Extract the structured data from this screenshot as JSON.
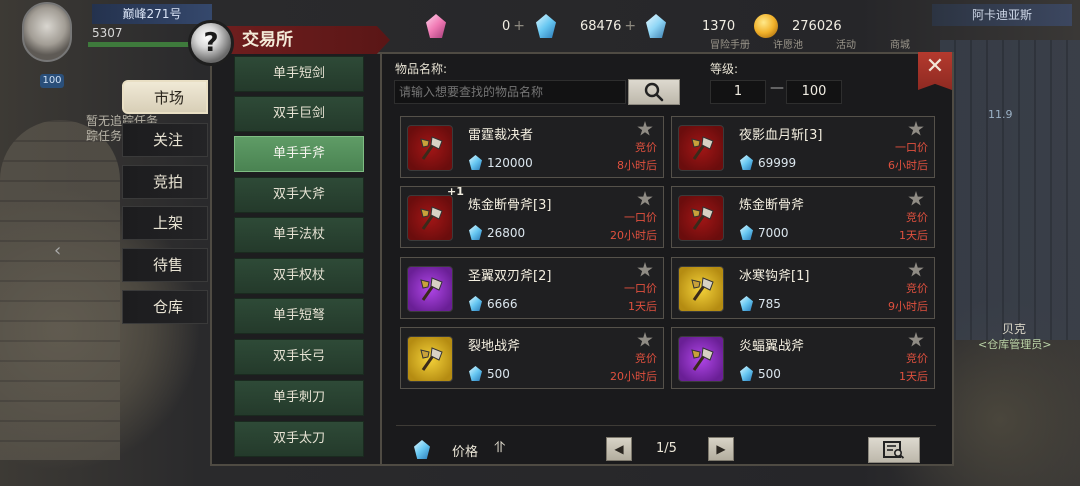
{
  "player": {
    "name": "巅峰271号",
    "hp": "5307",
    "level": "100"
  },
  "background": {
    "left_text": [
      "暂无追踪任务",
      "踪任务"
    ],
    "region": "阿卡迪亚斯",
    "npc_name": "贝克",
    "npc_role": "<仓库管理员>",
    "distance": "11.9"
  },
  "top_menu": [
    "冒险手册",
    "许愿池",
    "活动",
    "商城"
  ],
  "title": "交易所",
  "currencies": [
    {
      "icon": "pink-gem-icon",
      "value": "0"
    },
    {
      "icon": "blue-gem-icon",
      "value": "68476"
    },
    {
      "icon": "bound-gem-icon",
      "value": "1370"
    },
    {
      "icon": "gold-coin-icon",
      "value": "276026"
    }
  ],
  "side_tabs": [
    "市场",
    "关注",
    "竞拍",
    "上架",
    "待售",
    "仓库"
  ],
  "categories": [
    "单手短剑",
    "双手巨剑",
    "单手手斧",
    "双手大斧",
    "单手法杖",
    "双手权杖",
    "单手短弩",
    "双手长弓",
    "单手刺刀",
    "双手太刀"
  ],
  "active_category": "单手手斧",
  "search": {
    "name_label": "物品名称:",
    "placeholder": "请输入想要查找的物品名称",
    "level_label": "等级:",
    "level_min": "1",
    "level_max": "100"
  },
  "items": [
    {
      "name": "雷霆裁决者",
      "price": "120000",
      "type": "竞价",
      "time": "8小时后",
      "rarity": "red",
      "plus": ""
    },
    {
      "name": "夜影血月斩[3]",
      "price": "69999",
      "type": "一口价",
      "time": "6小时后",
      "rarity": "red",
      "plus": ""
    },
    {
      "name": "炼金断骨斧[3]",
      "price": "26800",
      "type": "一口价",
      "time": "20小时后",
      "rarity": "red",
      "plus": "+1"
    },
    {
      "name": "炼金断骨斧",
      "price": "7000",
      "type": "竞价",
      "time": "1天后",
      "rarity": "red",
      "plus": ""
    },
    {
      "name": "圣翼双刃斧[2]",
      "price": "6666",
      "type": "一口价",
      "time": "1天后",
      "rarity": "purple",
      "plus": ""
    },
    {
      "name": "冰寒钩斧[1]",
      "price": "785",
      "type": "竞价",
      "time": "9小时后",
      "rarity": "gold",
      "plus": ""
    },
    {
      "name": "裂地战斧",
      "price": "500",
      "type": "竞价",
      "time": "20小时后",
      "rarity": "gold",
      "plus": ""
    },
    {
      "name": "炎蝠翼战斧",
      "price": "500",
      "type": "竞价",
      "time": "1天后",
      "rarity": "purple",
      "plus": ""
    }
  ],
  "footer": {
    "sort_label": "价格",
    "sort_icon": "⥣",
    "page": "1/5",
    "prev": "◀",
    "next": "▶"
  }
}
